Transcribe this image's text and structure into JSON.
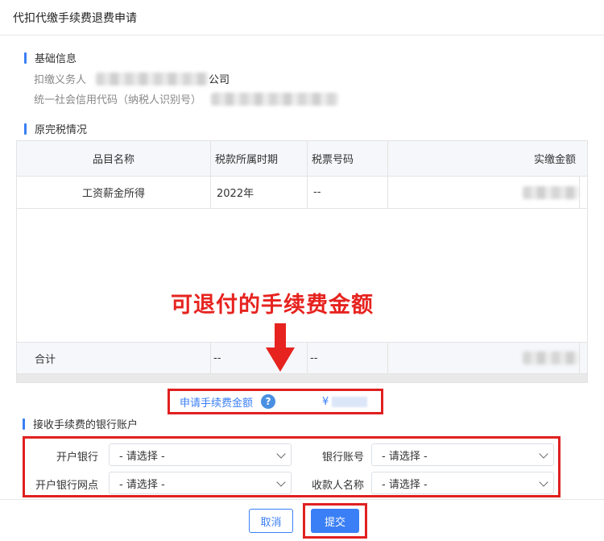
{
  "dialog": {
    "title": "代扣代缴手续费退费申请"
  },
  "basic_info": {
    "section_title": "基础信息",
    "withholder_label": "扣缴义务人",
    "withholder_suffix": "公司",
    "credit_code_label": "统一社会信用代码（纳税人识别号）"
  },
  "tax_section": {
    "section_title": "原完税情况",
    "columns": [
      "品目名称",
      "税款所属时期",
      "税票号码",
      "实缴金额"
    ],
    "rows": [
      {
        "item": "工资薪金所得",
        "period": "2022年",
        "ticket": "--"
      }
    ],
    "total": {
      "label": "合计",
      "period": "--",
      "ticket": "--"
    }
  },
  "annotation": {
    "text": "可退付的手续费金额"
  },
  "apply_fee": {
    "label": "申请手续费金额",
    "help_icon": "?",
    "currency": "¥"
  },
  "bank_section": {
    "section_title": "接收手续费的银行账户",
    "fields": [
      {
        "label": "开户银行",
        "value": "- 请选择 -"
      },
      {
        "label": "银行账号",
        "value": "- 请选择 -"
      },
      {
        "label": "开户银行网点",
        "value": "- 请选择 -"
      },
      {
        "label": "收款人名称",
        "value": "- 请选择 -"
      }
    ]
  },
  "actions": {
    "cancel_label": "取消",
    "submit_label": "提交"
  },
  "colors": {
    "accent": "#3a7ff5",
    "annotation_red": "#e02020"
  }
}
